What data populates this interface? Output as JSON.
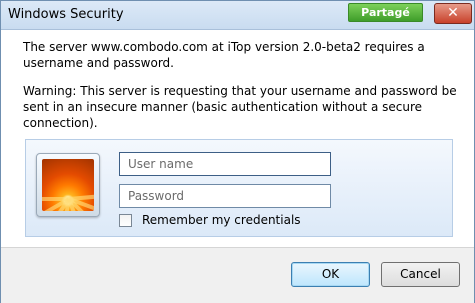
{
  "window": {
    "title": "Windows Security",
    "share_label": "Partagé",
    "close_symbol": "✕"
  },
  "message": {
    "line1": "The server www.combodo.com at iTop version 2.0-beta2 requires a username and password.",
    "warning": "Warning: This server is requesting that your username and password be sent in an insecure manner (basic authentication without a secure connection)."
  },
  "credentials": {
    "username_placeholder": "User name",
    "password_placeholder": "Password",
    "remember_label": "Remember my credentials",
    "remember_checked": false,
    "avatar_icon": "flower-avatar-icon"
  },
  "buttons": {
    "ok": "OK",
    "cancel": "Cancel"
  },
  "colors": {
    "share_green": "#3f9d2a",
    "close_red": "#c8412b",
    "panel_blue": "#dce9f8"
  }
}
